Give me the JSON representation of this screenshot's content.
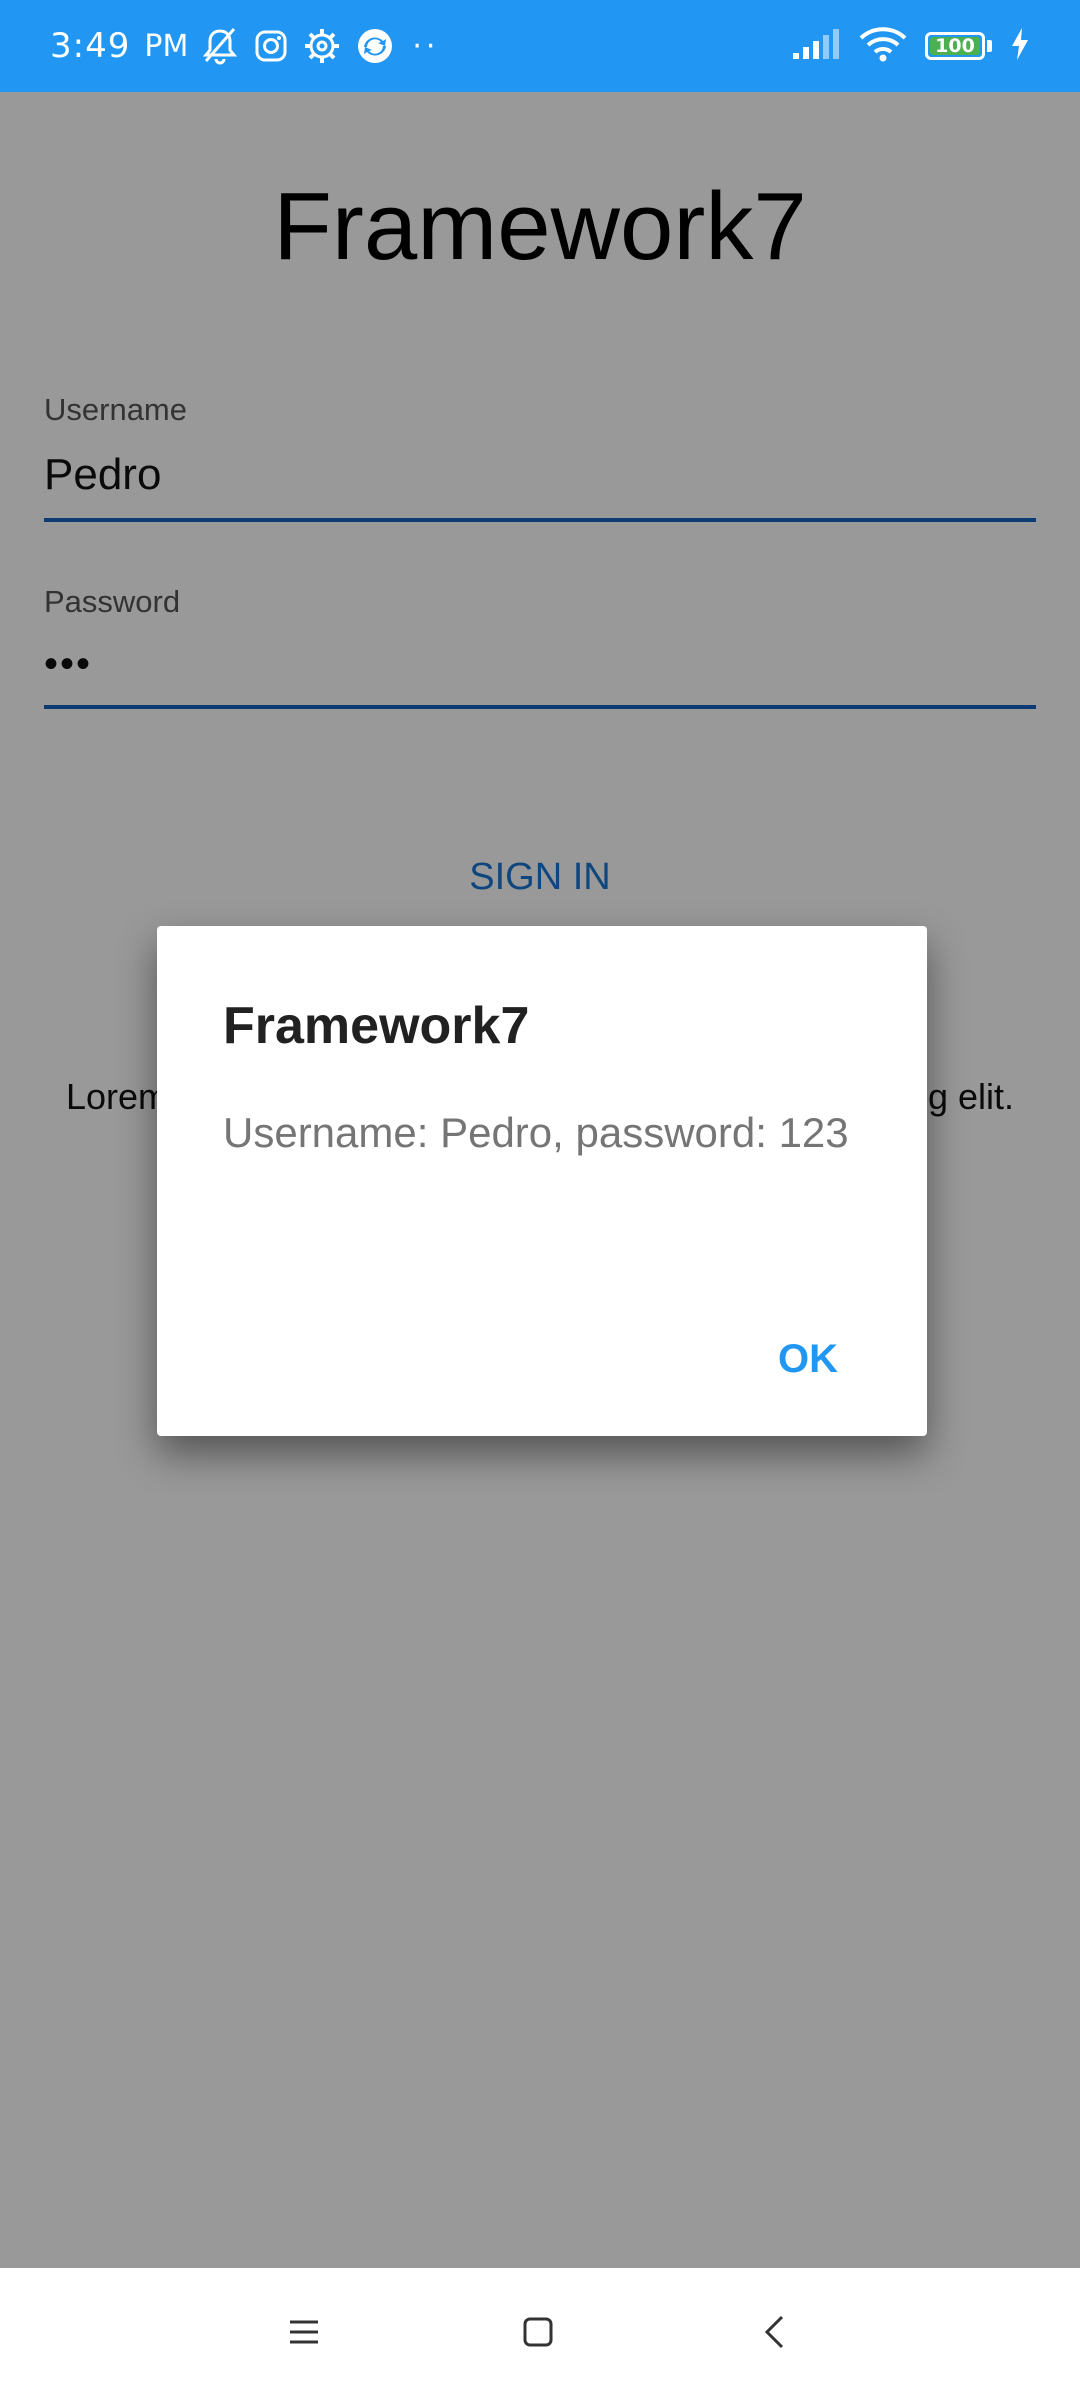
{
  "status_bar": {
    "time": "3:49",
    "ampm": "PM",
    "battery": "100",
    "battery_level": 1.0
  },
  "page": {
    "title": "Framework7",
    "username": {
      "label": "Username",
      "value": "Pedro"
    },
    "password": {
      "label": "Password",
      "value": "•••"
    },
    "signin_label": "SIGN IN",
    "lorem_left": "Lorem",
    "lorem_right": "g elit."
  },
  "dialog": {
    "title": "Framework7",
    "text": "Username: Pedro, password: 123",
    "ok_label": "OK"
  },
  "colors": {
    "status_bar": "#2196f3",
    "accent": "#2196f3",
    "input_underline": "#1565c0"
  }
}
